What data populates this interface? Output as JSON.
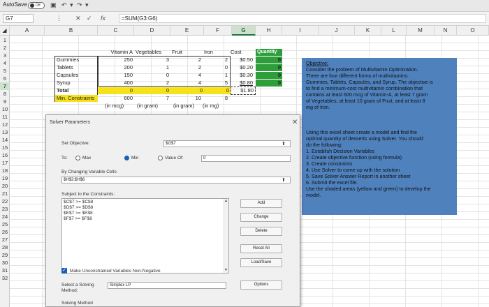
{
  "titlebar": {
    "autosave": "AutoSave",
    "toggle": "Off"
  },
  "formula": {
    "name_box": "G7",
    "fx": "fx",
    "cross": "✕",
    "check": "✓",
    "formula": "=SUM(G3:G6)"
  },
  "columns": [
    "A",
    "B",
    "C",
    "D",
    "E",
    "F",
    "G",
    "H",
    "I",
    "J",
    "K",
    "L",
    "M",
    "N",
    "O"
  ],
  "rows": [
    "1",
    "2",
    "3",
    "4",
    "5",
    "6",
    "7",
    "8",
    "9",
    "10",
    "11",
    "12",
    "13",
    "14",
    "15",
    "16",
    "17",
    "18",
    "19",
    "20",
    "21",
    "22",
    "23",
    "24",
    "25",
    "26",
    "27",
    "28",
    "29",
    "30",
    "31",
    "32"
  ],
  "sheet": {
    "headers": {
      "vitamin_a": "Vitamin A",
      "vegetables": "Vegetables",
      "fruit": "Fruit",
      "iron": "Iron",
      "cost": "Cost",
      "quantity": "Quantity"
    },
    "products": [
      {
        "name": "Gummies",
        "vitamin_a": "250",
        "veg": "3",
        "fruit": "2",
        "iron": "2",
        "cost": "$0.50",
        "qty": "0"
      },
      {
        "name": "Tablets",
        "vitamin_a": "200",
        "veg": "1",
        "fruit": "2",
        "iron": "0",
        "cost": "$0.20",
        "qty": "0"
      },
      {
        "name": "Capsules",
        "vitamin_a": "150",
        "veg": "0",
        "fruit": "4",
        "iron": "1",
        "cost": "$0.30",
        "qty": "0"
      },
      {
        "name": "Syrup",
        "vitamin_a": "400",
        "veg": "2",
        "fruit": "4",
        "iron": "5",
        "cost": "$0.80",
        "qty": "0"
      }
    ],
    "total": {
      "label": "Total",
      "vitamin_a": "0",
      "veg": "0",
      "fruit": "0",
      "iron": "0",
      "cost": "$1.80"
    },
    "min": {
      "label": "Min. Constraints",
      "vitamin_a": "600",
      "veg": "7",
      "fruit": "10",
      "iron": "8"
    },
    "units": {
      "vitamin_a": "(in mcg)",
      "veg": "(in gram)",
      "fruit": "(in gram)",
      "iron": "(in mg)"
    }
  },
  "solver": {
    "title": "Solver Parameters",
    "set_objective_label": "Set Objective:",
    "objective_value": "$G$7",
    "to_label": "To:",
    "max_label": "Max",
    "min_label": "Min",
    "value_of_label": "Value Of:",
    "value_of_value": "0",
    "changing_label": "By Changing Variable Cells:",
    "changing_value": "$H$3:$H$6",
    "subject_label": "Subject to the Constraints:",
    "constraints": [
      "$C$7 >= $C$8",
      "$D$7 >= $D$8",
      "$E$7 >= $E$8",
      "$F$7 >= $F$8"
    ],
    "buttons": {
      "add": "Add",
      "change": "Change",
      "delete": "Delete",
      "reset": "Reset All",
      "loadsave": "Load/Save",
      "options": "Options"
    },
    "nonneg_label": "Make Unconstrained Variables Non-Negative",
    "method_label_1": "Select a Solving",
    "method_label_2": "Method:",
    "method_value": "Simplex LP",
    "solving_method_label": "Solving Method"
  },
  "panel": {
    "heading": "Objective:",
    "p1_lines": [
      "Consider the problem of Multivitamin Optimization.",
      "There are four different forms of multivitamins:",
      "Gummies, Tablets, Capsules, and Syrup. The objective is",
      "to find a minimum-cost multivitamin combination that",
      "contains at least 600 mcg of Vitamin-A, at least 7 gram",
      "of Vegetables, at least 10 gram of Fruit, and at least 8",
      "mg of Iron."
    ],
    "p2_lines": [
      "Using this excel sheet create a model and find the",
      "optimal quantity of desserts using Solver. You should",
      "do the following:",
      "1. Establish Decision Variables",
      "2. Create objective function (using formula)",
      "3. Create constraints",
      "4. Use Solver to come up with the solution",
      "5. Save Solver Answer Report in another sheet",
      "6. Submit the excel file.",
      "Use the shaded areas (yellow and green) to develop the",
      "model."
    ]
  }
}
